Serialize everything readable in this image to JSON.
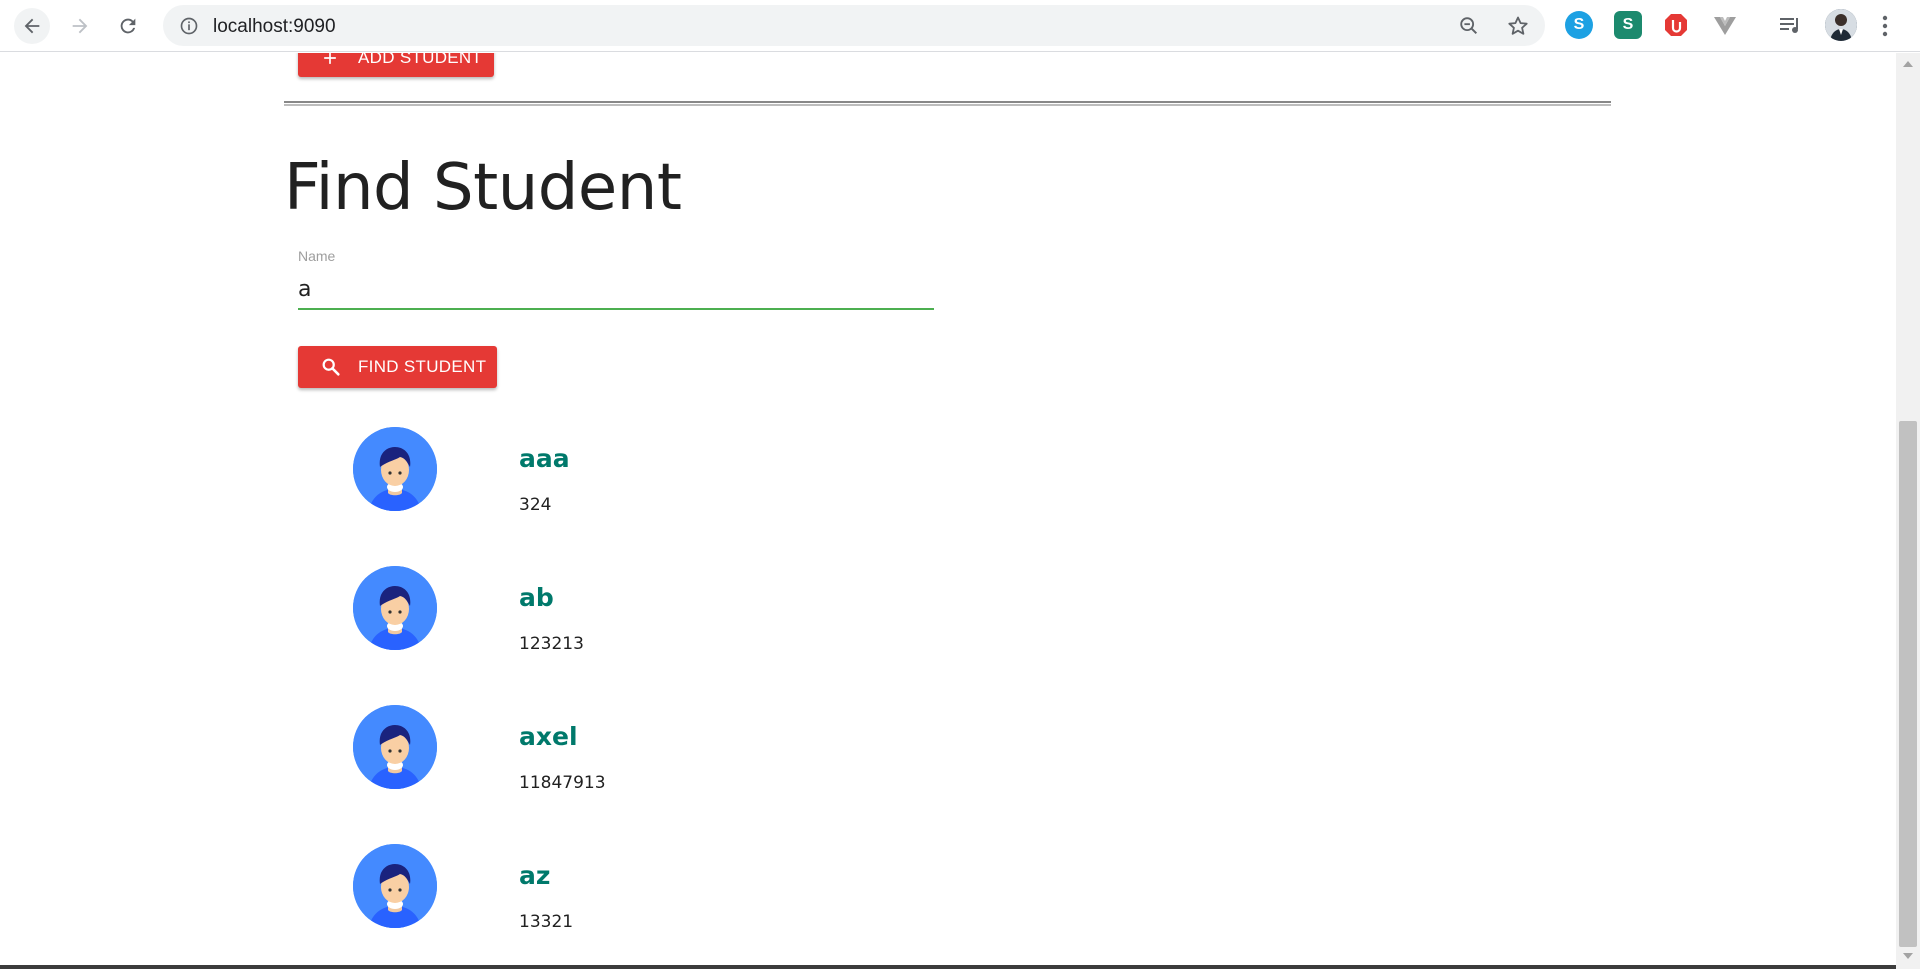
{
  "browser": {
    "url": "localhost:9090",
    "extensions": [
      "skype-icon",
      "s-extension-icon",
      "adblock-icon",
      "vue-devtools-icon",
      "media-queue-icon"
    ]
  },
  "page": {
    "add_button_label": "ADD STUDENT",
    "title": "Find Student",
    "search": {
      "label": "Name",
      "value": "a"
    },
    "find_button_label": "FIND STUDENT",
    "students": [
      {
        "name": "aaa",
        "id": "324"
      },
      {
        "name": "ab",
        "id": "123213"
      },
      {
        "name": "axel",
        "id": "11847913"
      },
      {
        "name": "az",
        "id": "13321"
      }
    ]
  },
  "colors": {
    "primary_button": "#e53935",
    "input_underline": "#4caf50",
    "student_name": "#00796b",
    "avatar_bg": "#448aff"
  }
}
